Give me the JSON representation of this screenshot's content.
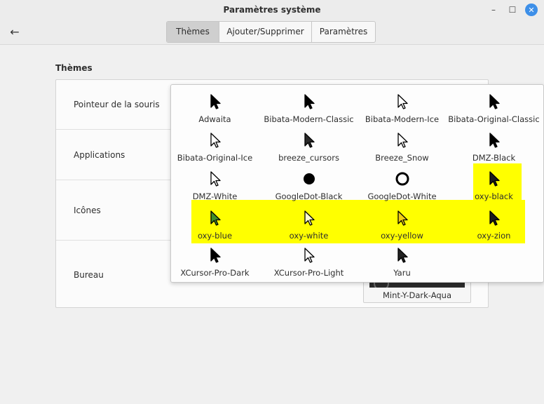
{
  "window": {
    "title": "Paramètres système",
    "minimize_glyph": "–",
    "maximize_glyph": "☐",
    "close_glyph": "✕",
    "close_color": "#3d8fe8"
  },
  "header": {
    "back_glyph": "←",
    "tabs": [
      {
        "label": "Thèmes",
        "active": true
      },
      {
        "label": "Ajouter/Supprimer",
        "active": false
      },
      {
        "label": "Paramètres",
        "active": false
      }
    ]
  },
  "themes": {
    "section_title": "Thèmes",
    "rows": [
      {
        "label": "Pointeur de la souris"
      },
      {
        "label": "Applications"
      },
      {
        "label": "Icônes"
      },
      {
        "label": "Bureau"
      }
    ],
    "desktop_value": "Mint-Y-Dark-Aqua"
  },
  "cursor_popover": {
    "highlight_color": "#ffff00",
    "items": [
      {
        "name": "Adwaita",
        "icon": "arrow-cursor-icon",
        "fill": "#000000"
      },
      {
        "name": "Bibata-Modern-Classic",
        "icon": "arrow-cursor-icon",
        "fill": "#000000"
      },
      {
        "name": "Bibata-Modern-Ice",
        "icon": "arrow-cursor-icon",
        "fill": "#ffffff"
      },
      {
        "name": "Bibata-Original-Classic",
        "icon": "arrow-cursor-icon",
        "fill": "#000000"
      },
      {
        "name": "Bibata-Original-Ice",
        "icon": "arrow-cursor-icon",
        "fill": "#ffffff"
      },
      {
        "name": "breeze_cursors",
        "icon": "arrow-cursor-icon",
        "fill": "#2a2a2a"
      },
      {
        "name": "Breeze_Snow",
        "icon": "arrow-cursor-icon",
        "fill": "#ffffff"
      },
      {
        "name": "DMZ-Black",
        "icon": "arrow-cursor-icon",
        "fill": "#000000"
      },
      {
        "name": "DMZ-White",
        "icon": "arrow-cursor-icon",
        "fill": "#ffffff"
      },
      {
        "name": "GoogleDot-Black",
        "icon": "dot-cursor-icon",
        "fill": "#000000"
      },
      {
        "name": "GoogleDot-White",
        "icon": "ring-cursor-icon",
        "fill": "#ffffff"
      },
      {
        "name": "oxy-black",
        "icon": "arrow-cursor-icon",
        "fill": "#1c1c1c",
        "highlighted": true
      },
      {
        "name": "oxy-blue",
        "icon": "arrow-cursor-icon",
        "fill": "#3f8f2a",
        "highlighted": true
      },
      {
        "name": "oxy-white",
        "icon": "arrow-cursor-icon",
        "fill": "#fdfdd0",
        "highlighted": true
      },
      {
        "name": "oxy-yellow",
        "icon": "arrow-cursor-icon",
        "fill": "#f2cd16",
        "highlighted": true
      },
      {
        "name": "oxy-zion",
        "icon": "arrow-cursor-icon",
        "fill": "#1c1c1c",
        "highlighted": true
      },
      {
        "name": "XCursor-Pro-Dark",
        "icon": "arrow-cursor-icon",
        "fill": "#000000"
      },
      {
        "name": "XCursor-Pro-Light",
        "icon": "arrow-cursor-icon",
        "fill": "#ffffff"
      },
      {
        "name": "Yaru",
        "icon": "arrow-cursor-icon",
        "fill": "#222222"
      }
    ]
  }
}
